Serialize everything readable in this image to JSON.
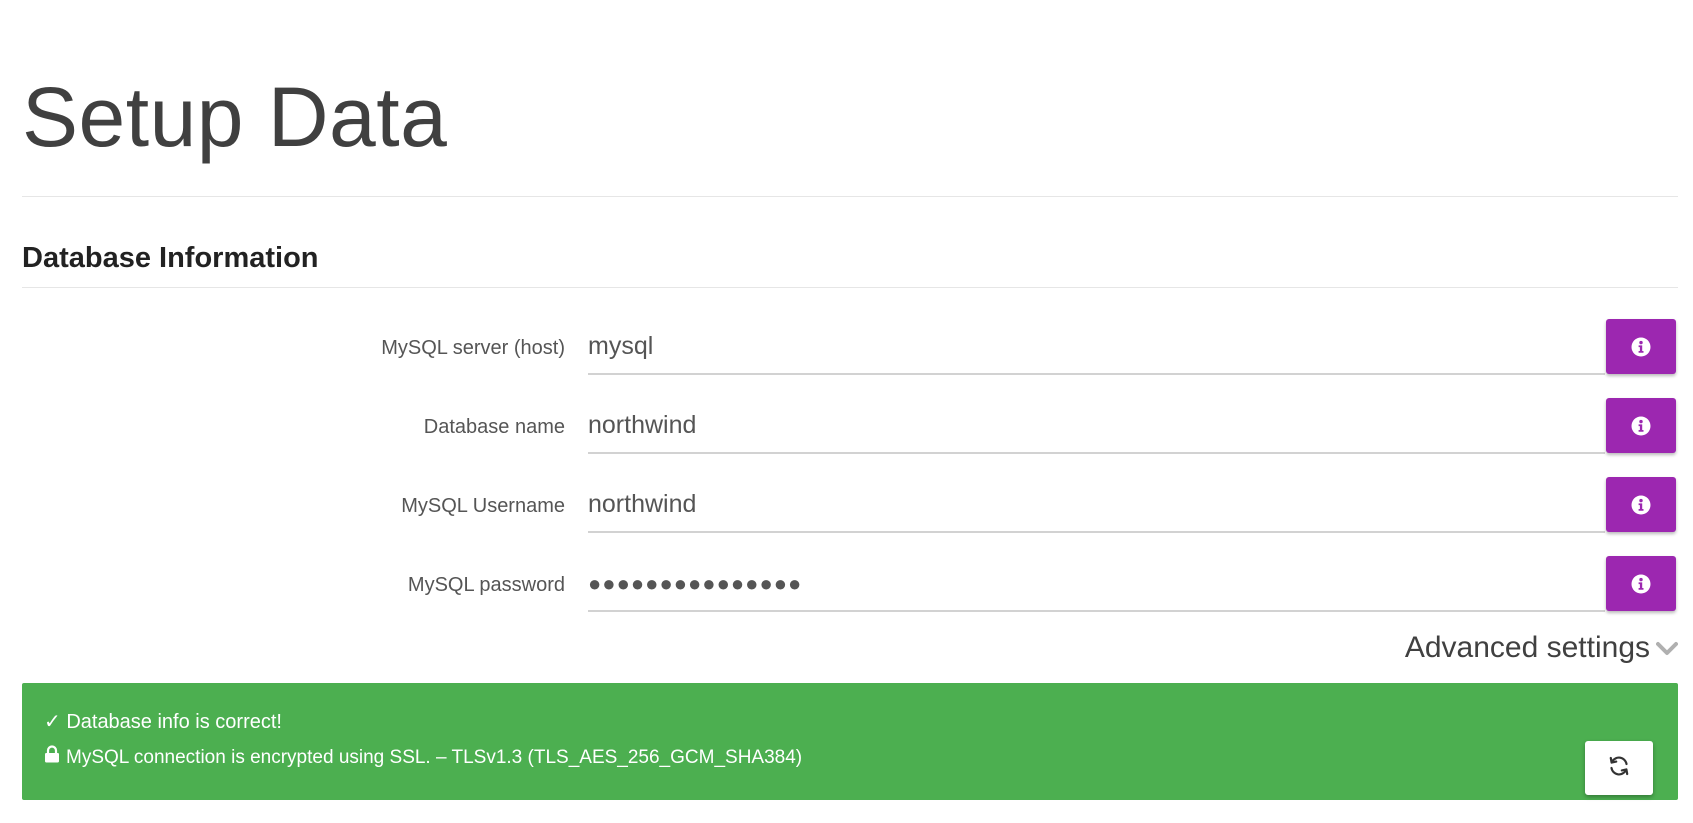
{
  "page": {
    "title": "Setup Data"
  },
  "section": {
    "title": "Database Information"
  },
  "fields": [
    {
      "label": "MySQL server (host)",
      "value": "mysql",
      "type": "text",
      "info_icon": "info-circle-icon"
    },
    {
      "label": "Database name",
      "value": "northwind",
      "type": "text",
      "info_icon": "info-circle-icon"
    },
    {
      "label": "MySQL Username",
      "value": "northwind",
      "type": "text",
      "info_icon": "info-circle-icon"
    },
    {
      "label": "MySQL password",
      "value": "●●●●●●●●●●●●●●●",
      "type": "password",
      "info_icon": "info-circle-icon"
    }
  ],
  "advanced": {
    "label": "Advanced settings",
    "icon": "chevron-down-icon"
  },
  "status": {
    "line1": "✓ Database info is correct!",
    "line2": "MySQL connection is encrypted using SSL. – TLSv1.3 (TLS_AES_256_GCM_SHA384)",
    "lock_icon": "lock-icon",
    "refresh_icon": "refresh-icon"
  },
  "colors": {
    "accent": "#9c27b0",
    "success": "#4caf50",
    "text": "#404040"
  }
}
